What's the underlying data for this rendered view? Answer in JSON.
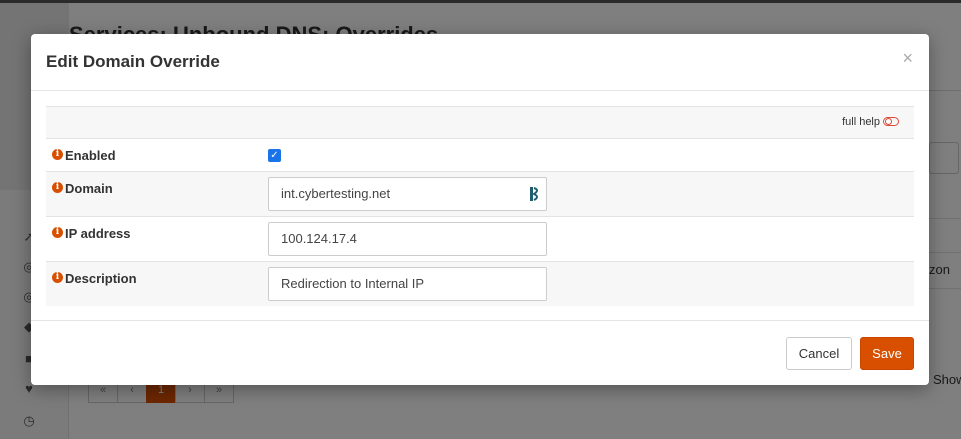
{
  "background": {
    "page_title": "Services: Unbound DNS: Overrides",
    "row_cell_fragment": "zon",
    "pager": [
      "«",
      "‹",
      "1",
      "›",
      "»"
    ],
    "show_text": "Show"
  },
  "modal": {
    "title": "Edit Domain Override",
    "close_symbol": "×",
    "full_help_label": "full help",
    "fields": {
      "enabled": {
        "label": "Enabled",
        "checked": true
      },
      "domain": {
        "label": "Domain",
        "value": "int.cybertesting.net"
      },
      "ip_address": {
        "label": "IP address",
        "value": "100.124.17.4"
      },
      "description": {
        "label": "Description",
        "value": "Redirection to Internal IP"
      }
    },
    "info_icon_glyph": "i",
    "buttons": {
      "cancel": "Cancel",
      "save": "Save"
    }
  },
  "colors": {
    "accent": "#d94f00",
    "checkbox": "#1a73e8"
  }
}
